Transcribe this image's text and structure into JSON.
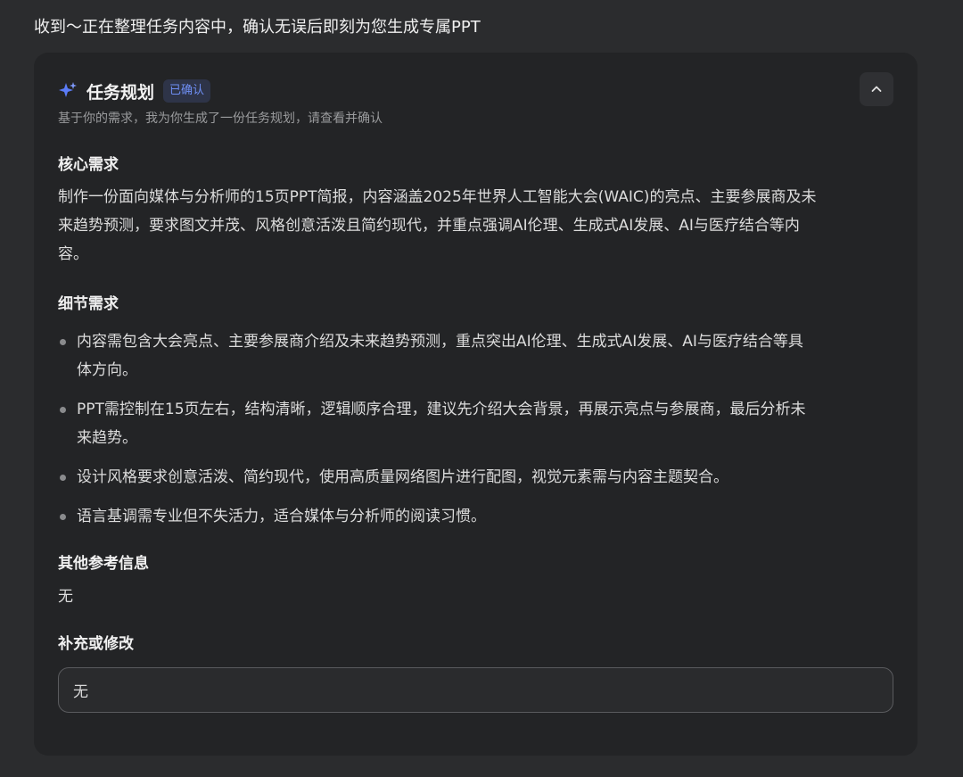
{
  "intro_message": "收到～正在整理任务内容中，确认无误后即刻为您生成专属PPT",
  "card": {
    "icon": "sparkle-icon",
    "title": "任务规划",
    "badge": "已确认",
    "subtitle": "基于你的需求，我为你生成了一份任务规划，请查看并确认",
    "collapse_icon": "chevron-up-icon"
  },
  "core": {
    "heading": "核心需求",
    "text_lines": [
      "制作一份面向媒体与分析师的15页PPT简报，内容涵盖2025年世界人工智能大会(WAIC)的亮点、主要参展商及未",
      "来趋势预测，要求图文并茂、风格创意活泼且简约现代，并重点强调AI伦理、生成式AI发展、AI与医疗结合等内",
      "容。"
    ]
  },
  "details": {
    "heading": "细节需求",
    "items": [
      [
        "内容需包含大会亮点、主要参展商介绍及未来趋势预测，重点突出AI伦理、生成式AI发展、AI与医疗结合等具",
        "体方向。"
      ],
      [
        "PPT需控制在15页左右，结构清晰，逻辑顺序合理，建议先介绍大会背景，再展示亮点与参展商，最后分析未",
        "来趋势。"
      ],
      [
        "设计风格要求创意活泼、简约现代，使用高质量网络图片进行配图，视觉元素需与内容主题契合。"
      ],
      [
        "语言基调需专业但不失活力，适合媒体与分析师的阅读习惯。"
      ]
    ]
  },
  "other": {
    "heading": "其他参考信息",
    "text": "无"
  },
  "supplement": {
    "heading": "补充或修改",
    "value": "无"
  },
  "colors": {
    "accent": "#6f8ff5",
    "background": "#2b2c2e",
    "card": "#232426"
  }
}
